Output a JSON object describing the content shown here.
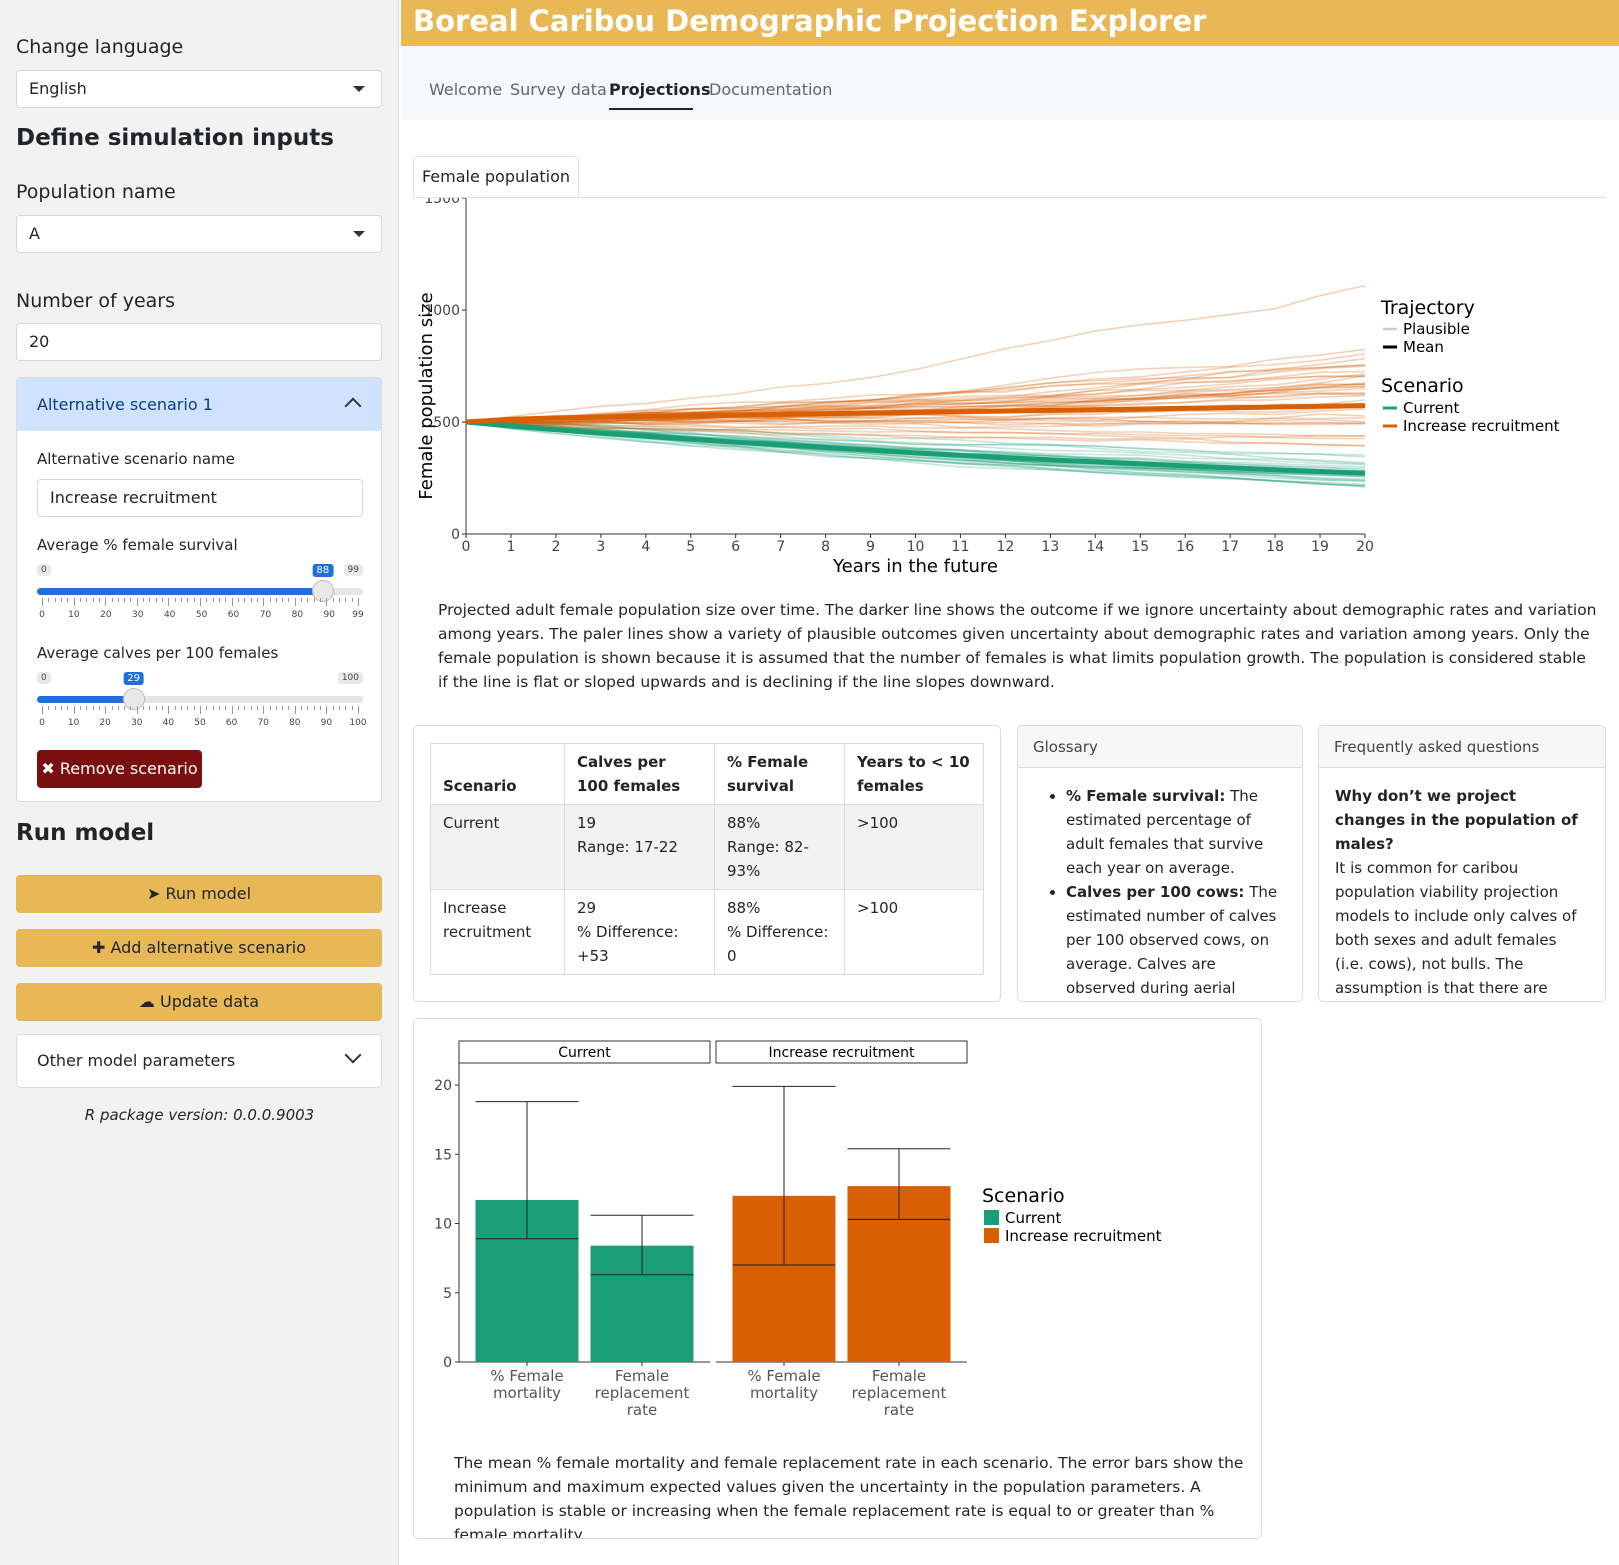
{
  "sidebar": {
    "language_label": "Change language",
    "language_value": "English",
    "define_heading": "Define simulation inputs",
    "population_label": "Population name",
    "population_value": "A",
    "years_label": "Number of years",
    "years_value": "20",
    "alt_scenario": {
      "header": "Alternative scenario 1",
      "name_label": "Alternative scenario name",
      "name_value": "Increase recruitment",
      "survival_label": "Average % female survival",
      "survival_slider": {
        "min": "0",
        "max": "99",
        "value": "88",
        "ticks": [
          "0",
          "10",
          "20",
          "30",
          "40",
          "50",
          "60",
          "70",
          "80",
          "90",
          "99"
        ]
      },
      "calves_label": "Average calves per 100 females",
      "calves_slider": {
        "min": "0",
        "max": "100",
        "value": "29",
        "ticks": [
          "0",
          "10",
          "20",
          "30",
          "40",
          "50",
          "60",
          "70",
          "80",
          "90",
          "100"
        ]
      },
      "remove_label": "Remove scenario",
      "remove_icon": "close-x-icon"
    },
    "run_heading": "Run model",
    "run_label": "Run model",
    "run_icon": "paper-plane-icon",
    "add_label": "Add alternative scenario",
    "add_icon": "plus-icon",
    "update_label": "Update data",
    "update_icon": "cloud-download-icon",
    "other_params_label": "Other model parameters",
    "version": "R package version: 0.0.0.9003"
  },
  "header": {
    "title": "Boreal Caribou Demographic Projection Explorer",
    "tabs": [
      "Welcome",
      "Survey data",
      "Projections",
      "Documentation"
    ],
    "active_tab": "Projections"
  },
  "colors": {
    "accent": "#e8b857",
    "current": "#1b9e77",
    "increase": "#d95f02",
    "remove_button": "#7b0f0f"
  },
  "plot_tab": "Female population",
  "chart_data": [
    {
      "type": "line",
      "title": "",
      "xlabel": "Years in the future",
      "ylabel": "Female population size",
      "xlim": [
        0,
        20
      ],
      "ylim": [
        0,
        1500
      ],
      "x_ticks": [
        "0",
        "1",
        "2",
        "3",
        "4",
        "5",
        "6",
        "7",
        "8",
        "9",
        "10",
        "11",
        "12",
        "13",
        "14",
        "15",
        "16",
        "17",
        "18",
        "19",
        "20"
      ],
      "y_ticks": [
        "0",
        "500",
        "1000",
        "1500"
      ],
      "legend_trajectory_title": "Trajectory",
      "legend_trajectory": [
        "Plausible",
        "Mean"
      ],
      "legend_scenario_title": "Scenario",
      "legend_scenario": [
        "Current",
        "Increase recruitment"
      ],
      "legend_placement": "right",
      "series": [
        {
          "name": "Current",
          "trajectory": "Mean",
          "x": [
            0,
            1,
            2,
            3,
            4,
            5,
            6,
            7,
            8,
            9,
            10,
            11,
            12,
            13,
            14,
            15,
            16,
            17,
            18,
            19,
            20
          ],
          "values": [
            500,
            482,
            465,
            450,
            436,
            423,
            410,
            398,
            386,
            374,
            362,
            351,
            341,
            331,
            322,
            313,
            304,
            295,
            287,
            279,
            272
          ]
        },
        {
          "name": "Increase recruitment",
          "trajectory": "Mean",
          "x": [
            0,
            1,
            2,
            3,
            4,
            5,
            6,
            7,
            8,
            9,
            10,
            11,
            12,
            13,
            14,
            15,
            16,
            17,
            18,
            19,
            20
          ],
          "values": [
            500,
            512,
            518,
            522,
            525,
            528,
            531,
            534,
            537,
            540,
            543,
            546,
            549,
            552,
            555,
            558,
            561,
            564,
            567,
            570,
            573
          ]
        }
      ]
    },
    {
      "type": "bar",
      "facets": [
        "Current",
        "Increase recruitment"
      ],
      "categories": [
        "% Female mortality",
        "Female replacement rate"
      ],
      "category_labels": [
        [
          "% Female",
          "mortality"
        ],
        [
          "Female",
          "replacement",
          "rate"
        ]
      ],
      "ylim": [
        0,
        20
      ],
      "y_ticks": [
        "0",
        "5",
        "10",
        "15",
        "20"
      ],
      "legend_title": "Scenario",
      "legend": [
        "Current",
        "Increase recruitment"
      ],
      "legend_placement": "right",
      "series": [
        {
          "name": "Current",
          "values": [
            11.7,
            8.4
          ],
          "error_low": [
            8.9,
            6.3
          ],
          "error_high": [
            18.8,
            10.6
          ]
        },
        {
          "name": "Increase recruitment",
          "values": [
            12.0,
            12.7
          ],
          "error_low": [
            7.0,
            10.3
          ],
          "error_high": [
            19.9,
            15.4
          ]
        }
      ]
    }
  ],
  "caption1": "Projected adult female population size over time. The darker line shows the outcome if we ignore uncertainty about demographic rates and variation among years. The paler lines show a variety of plausible outcomes given uncertainty about demographic rates and variation among years. Only the female population is shown because it is assumed that the number of females is what limits population growth. The population is considered stable if the line is flat or sloped upwards and is declining if the line slopes downward.",
  "summary_table": {
    "headers": [
      "Scenario",
      "Calves per 100 females",
      "% Female survival",
      "Years to < 10 females"
    ],
    "rows": [
      {
        "scenario": "Current",
        "calves": "19",
        "calves_sub": "Range: 17-22",
        "survival": "88%",
        "survival_sub": "Range: 82-93%",
        "years": ">100"
      },
      {
        "scenario": "Increase recruitment",
        "calves": "29",
        "calves_sub": "% Difference: +53",
        "survival": "88%",
        "survival_sub": "% Difference: 0",
        "years": ">100"
      }
    ]
  },
  "glossary": {
    "header": "Glossary",
    "items": [
      {
        "term": "% Female survival:",
        "text": " The estimated percentage of adult females that survive each year on average."
      },
      {
        "term": "Calves per 100 cows:",
        "text": " The estimated number of calves per 100 observed cows, on average. Calves are observed during aerial surveys typically"
      }
    ]
  },
  "faq": {
    "header": "Frequently asked questions",
    "question": "Why don’t we project changes in the population of males?",
    "answer": "It is common for caribou population viability projection models to include only calves of both sexes and adult females (i.e. cows), not bulls. The assumption is that there are enough bulls to allow cows to find mates. Often, only"
  },
  "caption2": "The mean % female mortality and female replacement rate in each scenario. The error bars show the minimum and maximum expected values given the uncertainty in the population parameters. A population is stable or increasing when the female replacement rate is equal to or greater than % female mortality."
}
